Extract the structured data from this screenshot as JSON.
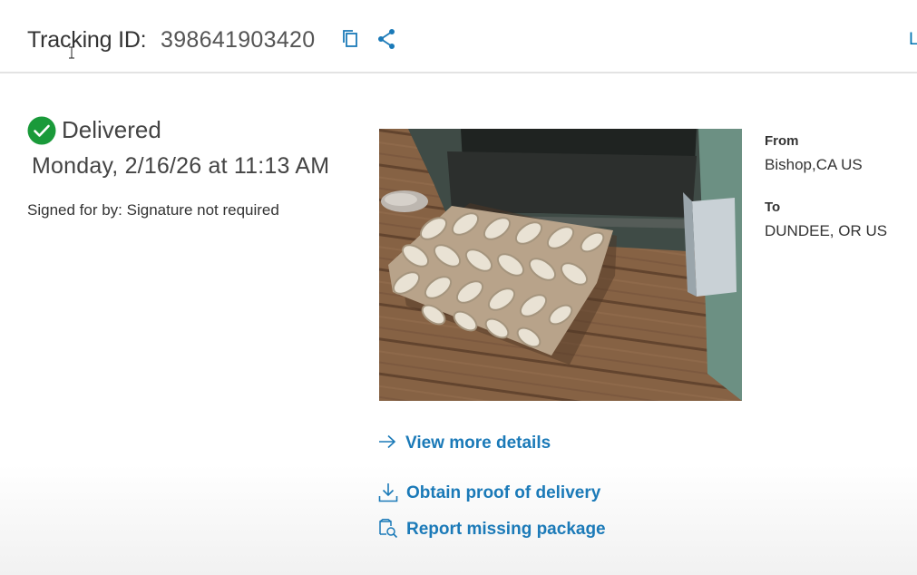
{
  "header": {
    "tracking_label": "Tracking ID:",
    "tracking_number": "398641903420",
    "edge_link_text": "L"
  },
  "status": {
    "label": "Delivered",
    "date": "Monday, 2/16/26 at 11:13 AM",
    "signed_for": "Signed for by: Signature not required",
    "color": "#1a9a3a"
  },
  "route": {
    "from_label": "From",
    "from_value": "Bishop,CA US",
    "to_label": "To",
    "to_value": "DUNDEE, OR US"
  },
  "actions": {
    "view_details": "View more details",
    "proof_of_delivery": "Obtain proof of delivery",
    "report_missing": "Report missing package"
  },
  "colors": {
    "link": "#1b7ab8",
    "icon": "#1b7ab8"
  },
  "icons": {
    "copy": "copy-icon",
    "share": "share-icon",
    "status": "checkmark-circle-icon",
    "details": "arrow-right-icon",
    "proof": "download-icon",
    "missing": "package-search-icon"
  }
}
